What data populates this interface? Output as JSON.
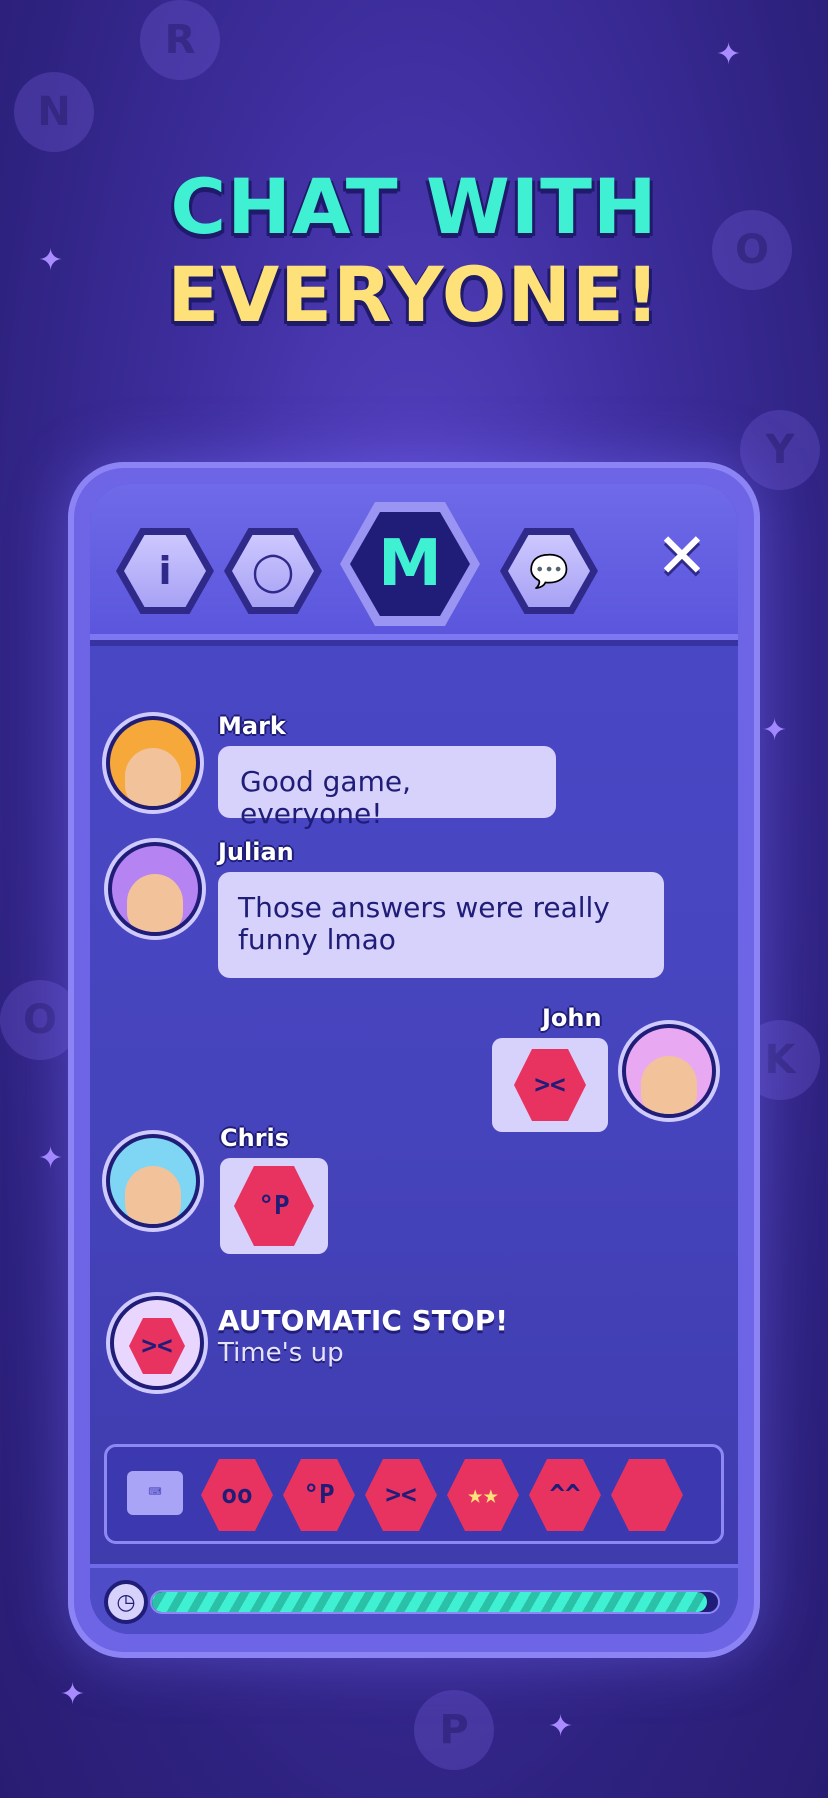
{
  "promo": {
    "headline_line1": "CHAT WITH",
    "headline_line2": "EVERYONE!"
  },
  "tabs": [
    {
      "icon": "info-icon",
      "glyph": "i"
    },
    {
      "icon": "user-icon",
      "glyph": "◯"
    },
    {
      "icon": "m-logo",
      "glyph": "M"
    },
    {
      "icon": "chat-icon",
      "glyph": "💬"
    }
  ],
  "close_glyph": "✕",
  "messages": [
    {
      "sender": "Mark",
      "text": "Good game, everyone!"
    },
    {
      "sender": "Julian",
      "text": "Those answers were really funny lmao"
    },
    {
      "sender": "John",
      "sticker": "angry-face-sticker"
    },
    {
      "sender": "Chris",
      "sticker": "silly-face-sticker"
    }
  ],
  "system_message": {
    "title": "AUTOMATIC STOP!",
    "subtitle": "Time's up"
  },
  "sticker_tray": {
    "keyboard_icon": "keyboard-icon",
    "stickers": [
      "wide-eyes-sticker",
      "silly-face-sticker",
      "angry-face-sticker",
      "star-eyes-sticker",
      "party-face-sticker"
    ]
  },
  "timer": {
    "icon": "clock-icon",
    "progress": 0.98
  },
  "colors": {
    "accent_teal": "#3ff0d2",
    "accent_yellow": "#ffe17a",
    "sticker_red": "#e8325f",
    "panel_blue": "#4b48c8"
  }
}
